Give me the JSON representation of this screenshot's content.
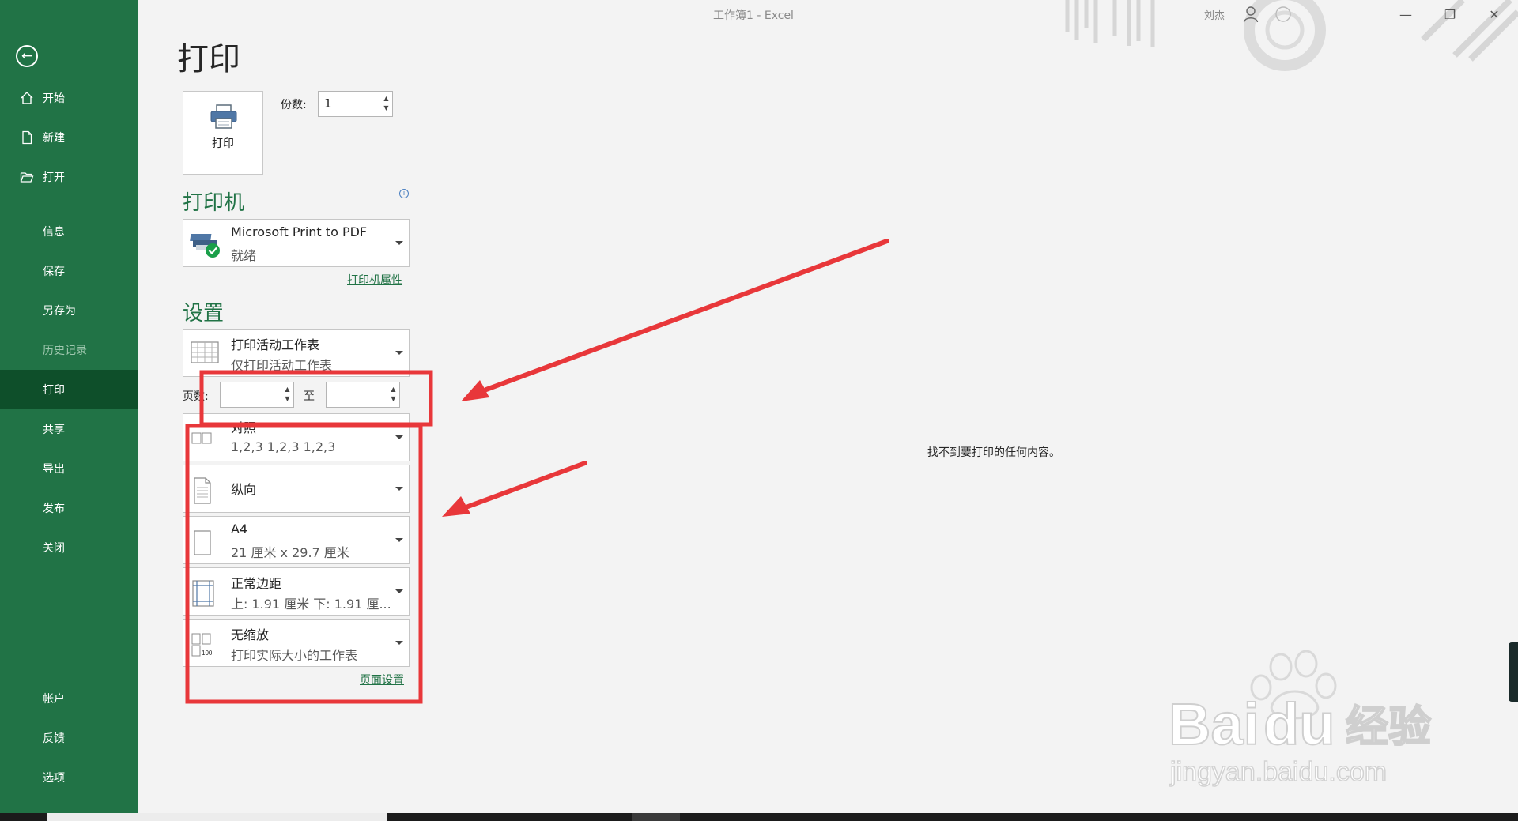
{
  "window": {
    "title": "工作簿1 - Excel",
    "user": "刘杰",
    "minimize": "—",
    "restore": "❐",
    "close": "✕"
  },
  "nav": {
    "back_icon": "back-arrow-icon",
    "items": [
      {
        "label": "开始",
        "icon": "home-icon"
      },
      {
        "label": "新建",
        "icon": "new-document-icon"
      },
      {
        "label": "打开",
        "icon": "open-folder-icon"
      },
      {
        "label": "信息"
      },
      {
        "label": "保存"
      },
      {
        "label": "另存为"
      },
      {
        "label": "历史记录",
        "state": "disabled"
      },
      {
        "label": "打印",
        "state": "active"
      },
      {
        "label": "共享"
      },
      {
        "label": "导出"
      },
      {
        "label": "发布"
      },
      {
        "label": "关闭"
      },
      {
        "label": "帐户"
      },
      {
        "label": "反馈"
      },
      {
        "label": "选项"
      }
    ]
  },
  "print": {
    "title": "打印",
    "button_label": "打印",
    "copies_label": "份数:",
    "copies_value": "1",
    "printer_heading": "打印机",
    "printer_name": "Microsoft Print to PDF",
    "printer_status": "就绪",
    "printer_properties": "打印机属性",
    "settings_heading": "设置",
    "scope": {
      "line1": "打印活动工作表",
      "line2": "仅打印活动工作表"
    },
    "pages_label": "页数:",
    "pages_to_label": "至",
    "pages_from": "",
    "pages_to": "",
    "collate": {
      "line1": "对照",
      "line2": "1,2,3    1,2,3    1,2,3"
    },
    "orientation": {
      "line1": "纵向"
    },
    "paper": {
      "line1": "A4",
      "line2": "21 厘米 x 29.7 厘米"
    },
    "margins": {
      "line1": "正常边距",
      "line2": "上: 1.91 厘米 下: 1.91 厘..."
    },
    "scaling": {
      "line1": "无缩放",
      "line2": "打印实际大小的工作表",
      "icon_text": "100"
    },
    "page_setup_link": "页面设置"
  },
  "preview": {
    "empty_message": "找不到要打印的任何内容。"
  },
  "watermark": {
    "brand": "Bai",
    "brand2": "du",
    "suffix": "经验",
    "url": "jingyan.baidu.com"
  },
  "colors": {
    "nav_bg": "#217346",
    "nav_active": "#0e4f2a",
    "accent": "#217346",
    "annotation": "#e8373a"
  }
}
